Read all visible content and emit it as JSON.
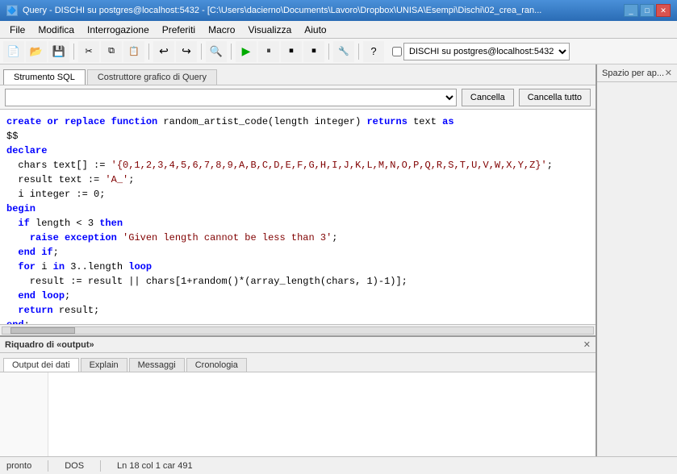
{
  "window": {
    "title": "Query - DISCHI su postgres@localhost:5432 - [C:\\Users\\dacierno\\Documents\\Lavoro\\Dropbox\\UNISA\\Esempi\\Dischi\\02_crea_ran...",
    "title_short": "Query - DISCHI su postgres@localhost:5432 - [C:\\Users\\dacierno\\Documents\\Lavoro\\Dropbox\\UNISA\\Esempi\\Dischi\\02_crea_ran..."
  },
  "menu": {
    "items": [
      "File",
      "Modifica",
      "Interrogazione",
      "Preferiti",
      "Macro",
      "Visualizza",
      "Aiuto"
    ]
  },
  "toolbar": {
    "buttons": [
      "📄",
      "📂",
      "💾",
      "✂️",
      "📋",
      "📄",
      "↩️",
      "↪️",
      "🔍",
      "▶️",
      "⏸️",
      "⏹️",
      "⏹️",
      "🔧"
    ],
    "server_label": "DISCHI su postgres@localhost:5432"
  },
  "tabs": {
    "main": [
      "Strumento SQL",
      "Costruttore grafico di Query"
    ]
  },
  "query_bar": {
    "placeholder": "",
    "cancel_btn": "Cancella",
    "cancel_all_btn": "Cancella tutto"
  },
  "editor": {
    "code": "create or replace function random_artist_code(length integer) returns text as\n$$\ndeclare\n  chars text[] := '{0,1,2,3,4,5,6,7,8,9,A,B,C,D,E,F,G,H,I,J,K,L,M,N,O,P,Q,R,S,T,U,V,W,X,Y,Z}';\n  result text := 'A_';\n  i integer := 0;\nbegin\n  if length < 3 then\n    raise exception 'Given length cannot be less than 3';\n  end if;\n  for i in 3..length loop\n    result := result || chars[1+random()*(array_length(chars, 1)-1)];\n  end loop;\n  return result;\nend;\n$$ language plpgsql;"
  },
  "right_panel": {
    "title": "Spazio per ap...",
    "close": "✕"
  },
  "output_panel": {
    "title": "Riquadro di «output»",
    "close": "✕",
    "tabs": [
      "Output dei dati",
      "Explain",
      "Messaggi",
      "Cronologia"
    ]
  },
  "status_bar": {
    "status": "pronto",
    "encoding": "DOS",
    "position": "Ln 18 col 1 car 491"
  }
}
